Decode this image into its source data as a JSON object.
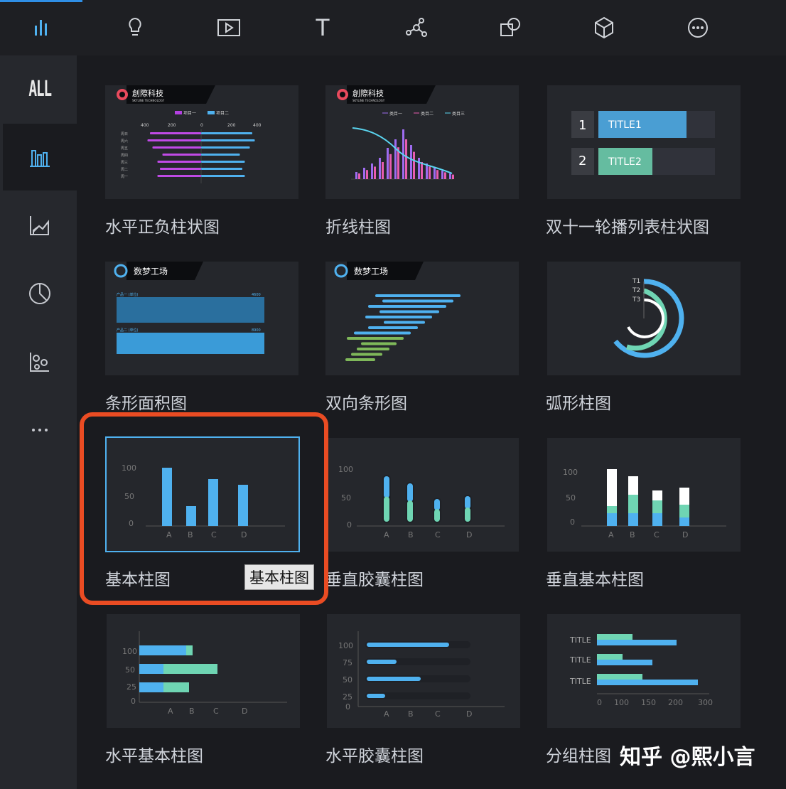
{
  "toolbar": {
    "items": [
      {
        "icon": "bar-chart-icon",
        "active": true
      },
      {
        "icon": "bulb-icon"
      },
      {
        "icon": "media-icon"
      },
      {
        "icon": "text-icon",
        "glyph": "T"
      },
      {
        "icon": "network-icon"
      },
      {
        "icon": "shapes-icon"
      },
      {
        "icon": "cube-icon"
      },
      {
        "icon": "more-icon"
      }
    ]
  },
  "sidebar": {
    "all_label": "ALL",
    "items": [
      "bar-chart-icon",
      "line-chart-icon",
      "pie-chart-icon",
      "scatter-chart-icon",
      "more-icon"
    ]
  },
  "cards": [
    {
      "label": "水平正负柱状图"
    },
    {
      "label": "折线柱图"
    },
    {
      "label": "双十一轮播列表柱状图"
    },
    {
      "label": "条形面积图"
    },
    {
      "label": "双向条形图"
    },
    {
      "label": "弧形柱图"
    },
    {
      "label": "基本柱图"
    },
    {
      "label": "垂直胶囊柱图"
    },
    {
      "label": "垂直基本柱图"
    },
    {
      "label": "水平基本柱图"
    },
    {
      "label": "水平胶囊柱图"
    },
    {
      "label": "分组柱图"
    }
  ],
  "thumb_text": {
    "brand1": "創際科技",
    "brand1_sub": "SKYLINE TECHNOLOGY",
    "brand2": "数梦工场",
    "legend_a": "项目一",
    "legend_b": "项目二",
    "cat1": "类目一",
    "cat2": "类目二",
    "cat3": "类目三",
    "title1": "TITLE1",
    "title2": "TITLE2",
    "num1": "1",
    "num2": "2",
    "t1": "T1",
    "t2": "T2",
    "t3": "T3",
    "title": "TITLE",
    "area_label1": "产品一 (单位)",
    "area_label2": "产品二 (单位)",
    "area_val1": "4600",
    "area_val2": "8900",
    "y100": "100",
    "y75": "75",
    "y50": "50",
    "y25": "25",
    "y0": "0",
    "xA": "A",
    "xB": "B",
    "xC": "C",
    "xD": "D",
    "gx0": "0",
    "gx100": "100",
    "gx150": "150",
    "gx200": "200",
    "gx300": "300",
    "neg400": "400",
    "neg200": "200",
    "pos200": "200",
    "pos400": "400",
    "days": [
      "周日",
      "周六",
      "周五",
      "周四",
      "周三",
      "周二",
      "周一"
    ]
  },
  "tooltip": "基本柱图",
  "watermark": "知乎 @熙小言",
  "colors": {
    "accent": "#2f8fe6",
    "highlight": "#ea4c23",
    "bar_blue": "#4fb1ef",
    "bar_green": "#6fd5b3"
  }
}
